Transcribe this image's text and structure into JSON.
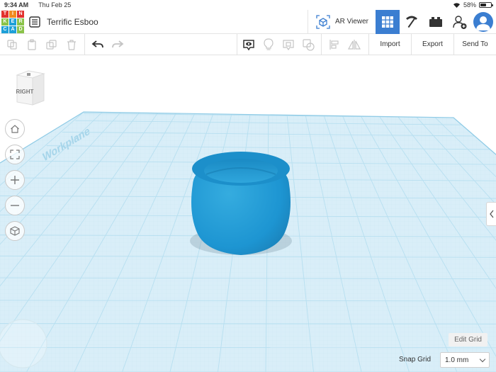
{
  "status_bar": {
    "time": "9:34 AM",
    "date": "Thu Feb 25",
    "battery": "58%",
    "battery_level": 0.58
  },
  "app": {
    "logo_letters": [
      "T",
      "I",
      "N",
      "K",
      "E",
      "R",
      "C",
      "A",
      "D"
    ],
    "logo_colors": [
      "#e2322e",
      "#f18b1e",
      "#e2322e",
      "#8bc34a",
      "#1ea0d8",
      "#8bc34a",
      "#1ea0d8",
      "#1ea0d8",
      "#8bc34a"
    ],
    "design_title": "Terrific Esboo",
    "accent": "#3b7ed1"
  },
  "header": {
    "ar_viewer_label": "AR Viewer"
  },
  "toolbar": {
    "import_label": "Import",
    "export_label": "Export",
    "send_to_label": "Send To"
  },
  "workplane": {
    "label": "Workplane",
    "grid_color": "#b7dff0",
    "plane_color": "#d9eef8",
    "object_color": "#1d95d2",
    "viewcube_label": "RIGHT"
  },
  "footer": {
    "edit_grid_label": "Edit Grid",
    "snap_grid_label": "Snap Grid",
    "snap_grid_value": "1.0 mm"
  }
}
